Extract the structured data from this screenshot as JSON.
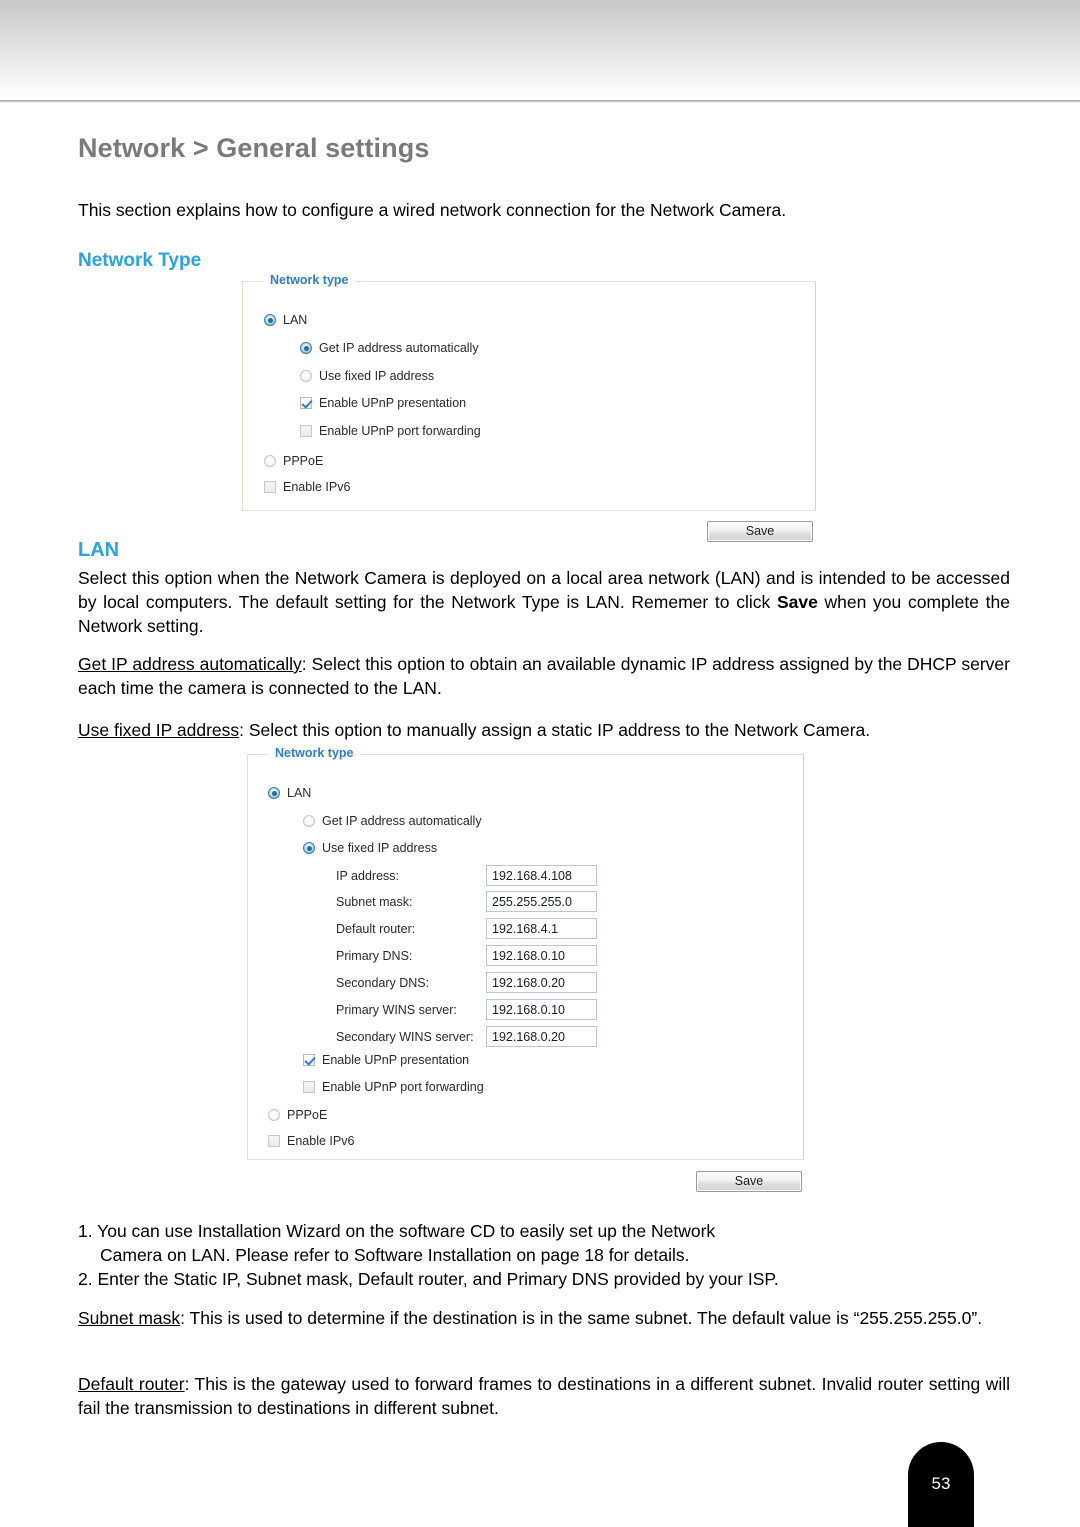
{
  "page": {
    "title": "Network > General settings",
    "intro": "This section explains how to configure a wired network connection for the Network Camera.",
    "number": "53"
  },
  "sections": {
    "network_type_heading": "Network Type",
    "lan_heading": "LAN"
  },
  "panel1": {
    "legend": "Network type",
    "options": {
      "lan": "LAN",
      "get_ip_auto": "Get IP address automatically",
      "use_fixed_ip": "Use fixed IP address",
      "enable_upnp_presentation": "Enable UPnP presentation",
      "enable_upnp_port_forwarding": "Enable UPnP port forwarding",
      "pppoe": "PPPoE",
      "enable_ipv6": "Enable IPv6"
    },
    "states": {
      "lan": "selected",
      "get_ip_auto": "selected",
      "use_fixed_ip": "unselected",
      "enable_upnp_presentation": "checked",
      "enable_upnp_port_forwarding": "unchecked",
      "pppoe": "unselected",
      "enable_ipv6": "unchecked"
    },
    "save_label": "Save"
  },
  "panel2": {
    "legend": "Network type",
    "options": {
      "lan": "LAN",
      "get_ip_auto": "Get IP address automatically",
      "use_fixed_ip": "Use fixed IP address",
      "enable_upnp_presentation": "Enable UPnP presentation",
      "enable_upnp_port_forwarding": "Enable UPnP port forwarding",
      "pppoe": "PPPoE",
      "enable_ipv6": "Enable IPv6"
    },
    "states": {
      "lan": "selected",
      "get_ip_auto": "unselected",
      "use_fixed_ip": "selected",
      "enable_upnp_presentation": "checked",
      "enable_upnp_port_forwarding": "unchecked",
      "pppoe": "unselected",
      "enable_ipv6": "unchecked"
    },
    "fields": [
      {
        "label": "IP address:",
        "value": "192.168.4.108"
      },
      {
        "label": "Subnet mask:",
        "value": "255.255.255.0"
      },
      {
        "label": "Default router:",
        "value": "192.168.4.1"
      },
      {
        "label": "Primary DNS:",
        "value": "192.168.0.10"
      },
      {
        "label": "Secondary DNS:",
        "value": "192.168.0.20"
      },
      {
        "label": "Primary WINS server:",
        "value": "192.168.0.10"
      },
      {
        "label": "Secondary WINS server:",
        "value": "192.168.0.20"
      }
    ],
    "save_label": "Save"
  },
  "body": {
    "lan_para_1": "Select this option when the Network Camera is deployed on a local area network (LAN) and is intended to be accessed by local computers. The default setting for the Network Type is LAN. Rememer to click ",
    "lan_para_1_bold": "Save",
    "lan_para_1_tail": " when you complete the Network setting.",
    "get_ip_term": "Get IP address automatically",
    "get_ip_desc": ": Select this option to obtain an available dynamic IP address assigned by the DHCP server each time the camera is connected to the LAN.",
    "use_fixed_term": "Use fixed IP address",
    "use_fixed_desc": ": Select this option to manually assign a static IP address to the Network Camera.",
    "note_1": "1. You can use Installation Wizard on the software CD to easily set up the Network",
    "note_1_cont": "Camera on LAN. Please refer to Software Installation on page 18 for details.",
    "note_2": "2. Enter the Static IP, Subnet mask, Default router, and Primary DNS provided by your ISP.",
    "subnet_term": "Subnet mask",
    "subnet_desc": ": This is used to determine if the destination is in the same subnet. The default value is “255.255.255.0”.",
    "router_term": "Default router",
    "router_desc": ": This is the gateway used to forward frames to destinations in a different subnet. Invalid router setting will fail the transmission to destinations in different subnet."
  },
  "colors": {
    "heading_gray": "#7a7a7a",
    "accent_blue": "#2aa3e0",
    "legend_blue": "#2f7fc6"
  }
}
